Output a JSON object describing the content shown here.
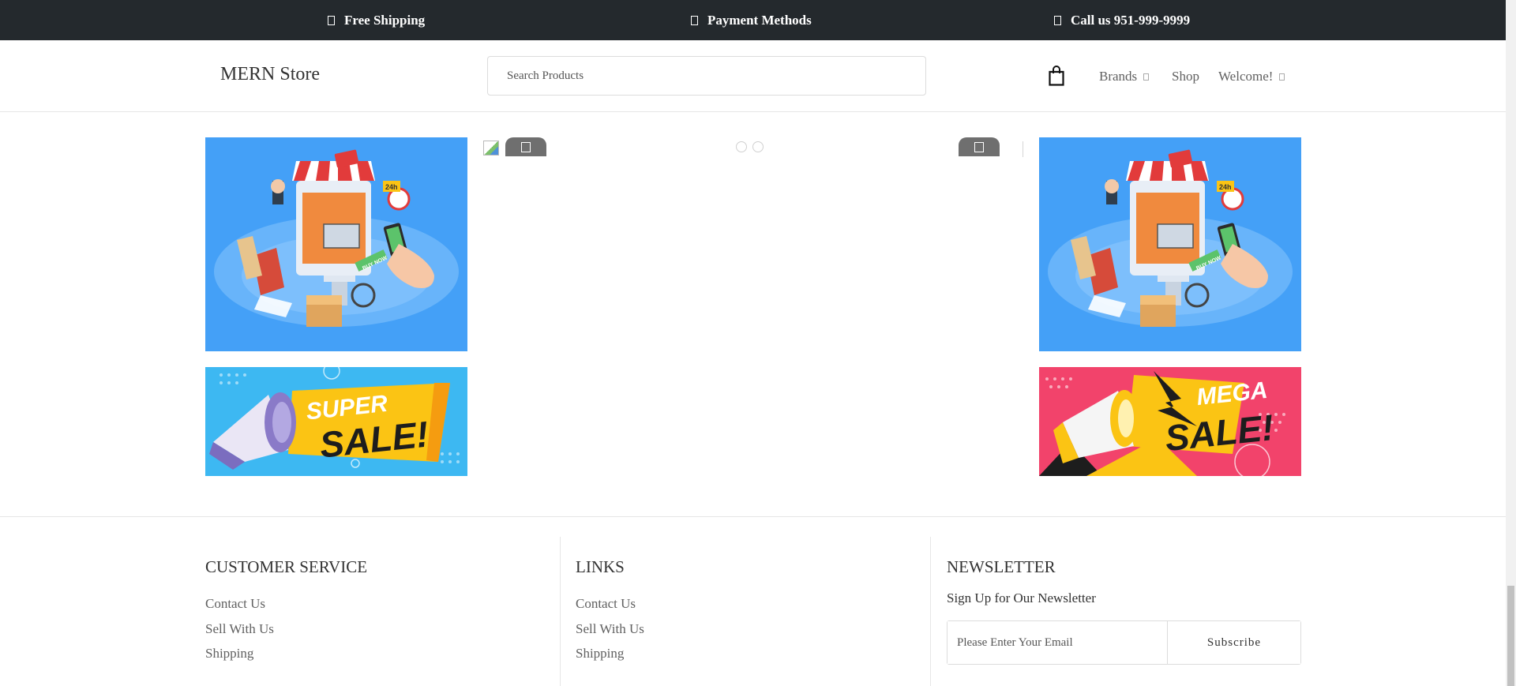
{
  "topbar": {
    "free_shipping": "Free Shipping",
    "payment_methods": "Payment Methods",
    "call_us": "Call us 951-999-9999"
  },
  "header": {
    "logo": "MERN Store",
    "search_placeholder": "Search Products",
    "nav": {
      "brands": "Brands",
      "shop": "Shop",
      "welcome": "Welcome!"
    }
  },
  "banners": {
    "left_sale_line1": "SUPER",
    "left_sale_line2": "SALE!",
    "right_sale_line1": "MEGA",
    "right_sale_line2": "SALE!",
    "scene_badge": "24h",
    "scene_buy": "BUY NOW"
  },
  "footer": {
    "customer_service": {
      "title": "CUSTOMER SERVICE",
      "links": [
        "Contact Us",
        "Sell With Us",
        "Shipping"
      ]
    },
    "links": {
      "title": "LINKS",
      "links": [
        "Contact Us",
        "Sell With Us",
        "Shipping"
      ]
    },
    "newsletter": {
      "title": "NEWSLETTER",
      "subtitle": "Sign Up for Our Newsletter",
      "email_placeholder": "Please Enter Your Email",
      "subscribe_label": "Subscribe"
    }
  },
  "colors": {
    "topbar_bg": "#24292d",
    "banner_blue": "#44a0f7",
    "super_sale_bg": "#3db8f2",
    "mega_sale_bg": "#f2436b",
    "sale_yellow": "#fbc414"
  }
}
